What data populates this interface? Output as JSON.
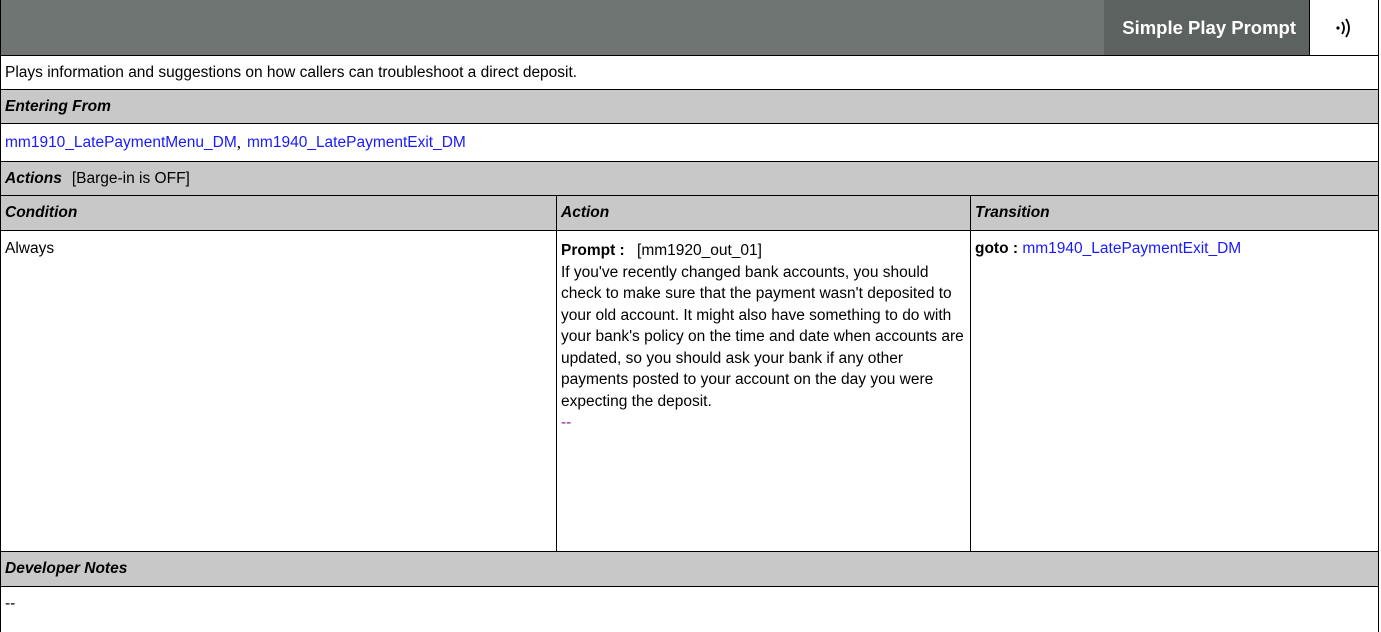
{
  "header": {
    "title": "Simple Play Prompt",
    "icon": "speaker-audio-icon"
  },
  "description": "Plays information and suggestions on how callers can troubleshoot a direct deposit.",
  "entering_from": {
    "label": "Entering From",
    "links": [
      "mm1910_LatePaymentMenu_DM",
      "mm1940_LatePaymentExit_DM"
    ],
    "separator": ","
  },
  "actions": {
    "label": "Actions",
    "barge_in": "[Barge-in is OFF]",
    "columns": [
      "Condition",
      "Action",
      "Transition"
    ],
    "row": {
      "condition": "Always",
      "prompt_label": "Prompt :",
      "prompt_id": "[mm1920_out_01]",
      "prompt_text": "If you've recently changed bank accounts, you should check to make sure that the payment wasn't deposited to your old account. It might also have something to do with your bank's policy on the time and date when accounts are updated, so you should ask your bank if any other payments posted to your account on the day you were expecting the deposit.",
      "prompt_dash": "--",
      "transition_label": "goto :",
      "transition_target": "mm1940_LatePaymentExit_DM"
    }
  },
  "developer_notes": {
    "label": "Developer Notes",
    "text": "--"
  }
}
